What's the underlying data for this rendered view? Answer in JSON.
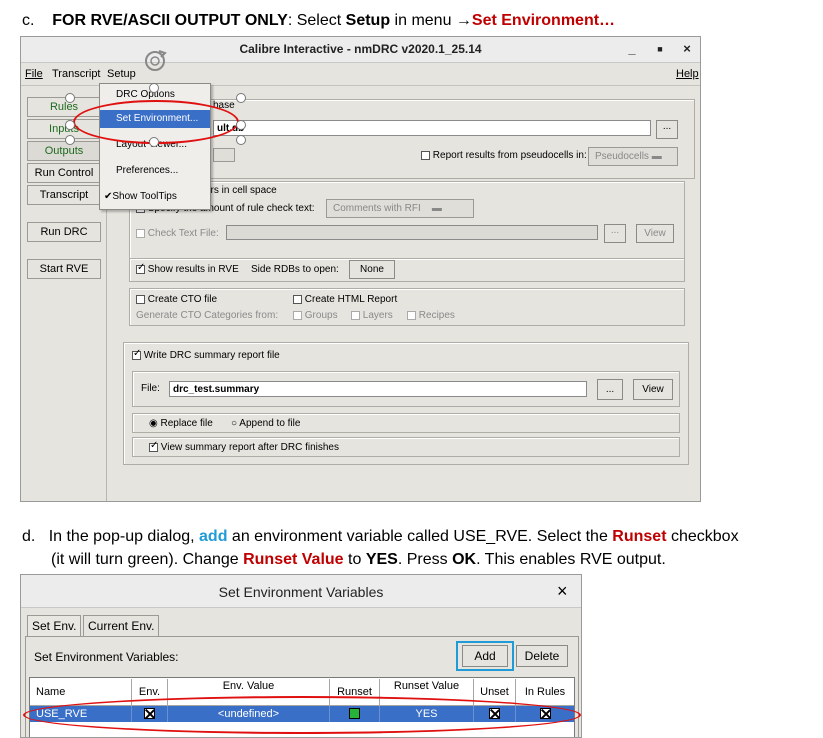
{
  "step_c": {
    "letter": "c.",
    "bold_prefix": "FOR RVE/ASCII OUTPUT ONLY",
    "text_mid": ": Select ",
    "setup_word": "Setup",
    "text_in_menu": " in menu ",
    "arrow": "→",
    "target": "Set Environment…"
  },
  "window": {
    "title": "Calibre Interactive - nmDRC v2020.1_25.14",
    "btn_min": "_",
    "btn_max": "■",
    "btn_close": "×",
    "menu": {
      "file": "File",
      "transcript": "Transcript",
      "setup": "Setup",
      "help": "Help"
    },
    "sidebar": [
      "Rules",
      "Inputs",
      "Outputs",
      "Run Control",
      "Transcript",
      "Run DRC",
      "Start RVE"
    ],
    "dropdown": [
      "DRC Options",
      "Set Environment...",
      "Layout Viewer...",
      "Preferences...",
      "Show ToolTips"
    ],
    "dropdown_check": "✔",
    "fragments": {
      "base": "base",
      "ult": "ult.db"
    },
    "browse": "...",
    "view": "View",
    "report_pseudo": "Report results from pseudocells in:",
    "pseudocells": "Pseudocells",
    "errors_cell_space": "ors in cell space",
    "specify_rule_text": "Specify the amount of rule check text:",
    "comments_rfi": "Comments with RFI",
    "check_text_file": "Check Text File:",
    "show_rve": "Show results in RVE",
    "side_rdbs": "Side RDBs to open:",
    "none": "None",
    "create_cto": "Create CTO file",
    "create_html": "Create HTML Report",
    "gen_cto": "Generate CTO Categories from:",
    "groups": "Groups",
    "layers": "Layers",
    "recipes": "Recipes",
    "write_summary": "Write DRC summary report file",
    "file_label": "File:",
    "file_value": "drc_test.summary",
    "replace_file": "Replace file",
    "append_file": "Append to file",
    "view_summary": "View summary report after DRC finishes"
  },
  "step_d": {
    "letter": "d.",
    "t1": "In the pop-up dialog, ",
    "add": "add",
    "t2": " an environment variable called USE_RVE. Select the ",
    "runset": "Runset",
    "t3": " checkbox",
    "t4": "(it will turn green). Change ",
    "runset_value": "Runset Value",
    "t5": " to ",
    "yes": "YES",
    "t6": ". Press ",
    "ok": "OK",
    "t7": ". This enables RVE output."
  },
  "dialog": {
    "title": "Set Environment Variables",
    "close": "×",
    "tab1": "Set Env.",
    "tab2": "Current Env.",
    "label": "Set Environment Variables:",
    "add": "Add",
    "delete": "Delete",
    "headers": [
      "Name",
      "Env.",
      "Env. Value",
      "Runset",
      "Runset Value",
      "Unset",
      "In Rules"
    ],
    "row": {
      "name": "USE_RVE",
      "env_value": "<undefined>",
      "runset_value": "YES"
    }
  },
  "colors": {
    "highlight_red": "#e01010",
    "runset_green": "#27b23a",
    "add_blue": "#1f9bd7",
    "row_blue": "#3a6fc8"
  }
}
